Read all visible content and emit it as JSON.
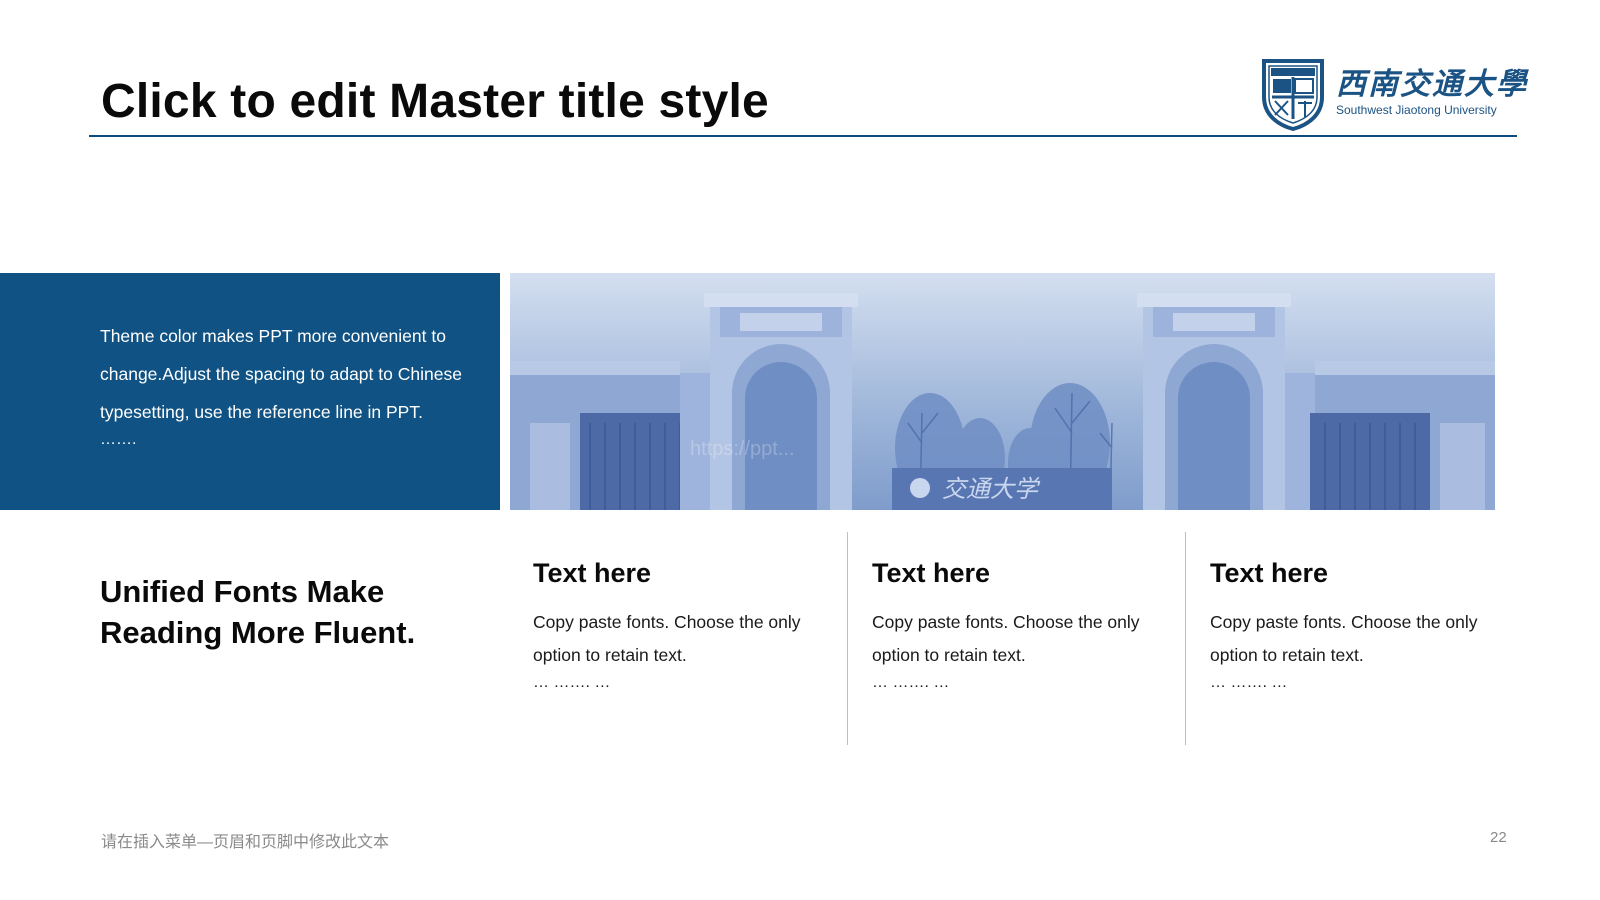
{
  "slide": {
    "title": "Click to edit Master title style",
    "logo": {
      "name_cn": "西南交通大學",
      "name_en": "Southwest Jiaotong University"
    },
    "intro_text": "Theme color makes PPT more convenient to change.Adjust the spacing to adapt to Chinese typesetting, use the reference line in PPT.",
    "intro_dots": "…….",
    "photo": {
      "watermark": "https://ppt...",
      "gate_sign": "交通大学"
    },
    "side_heading": "Unified Fonts Make Reading More Fluent.",
    "columns": [
      {
        "title": "Text here",
        "body": "Copy paste fonts. Choose the only option to retain text.",
        "dots": "… ……. …"
      },
      {
        "title": "Text here",
        "body": "Copy paste fonts. Choose the only option to retain text.",
        "dots": "… ……. …"
      },
      {
        "title": "Text here",
        "body": "Copy paste fonts. Choose the only option to retain text.",
        "dots": "… ……. …"
      }
    ],
    "footer_text": "请在插入菜单—页眉和页脚中修改此文本",
    "page_number": "22"
  },
  "colors": {
    "theme_blue": "#0f5283",
    "rule_blue": "#0d4c7d",
    "muted_gray": "#8a8a8a"
  }
}
